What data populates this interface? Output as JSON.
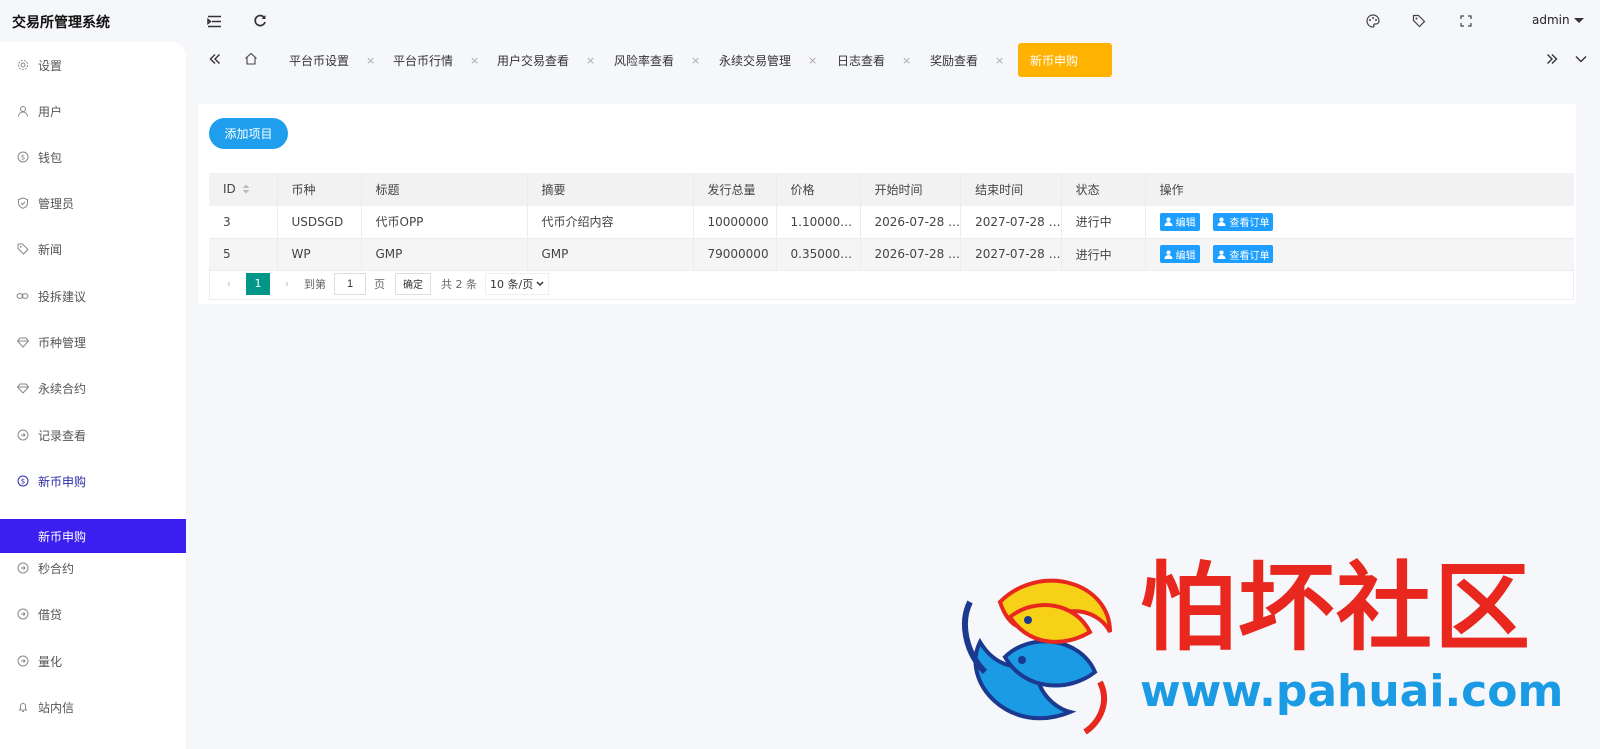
{
  "header": {
    "title": "交易所管理系统",
    "user": "admin",
    "icons": [
      "menu-fold-icon",
      "refresh-icon",
      "theme-icon",
      "tag-icon",
      "fullscreen-icon"
    ]
  },
  "sidebar": {
    "items": [
      {
        "label": "设置",
        "icon": "gear-icon"
      },
      {
        "label": "用户",
        "icon": "user-icon"
      },
      {
        "label": "钱包",
        "icon": "dollar-circle-icon"
      },
      {
        "label": "管理员",
        "icon": "shield-icon"
      },
      {
        "label": "新闻",
        "icon": "tag-icon"
      },
      {
        "label": "投拆建议",
        "icon": "link-icon"
      },
      {
        "label": "币种管理",
        "icon": "diamond-icon"
      },
      {
        "label": "永续合约",
        "icon": "diamond-icon"
      },
      {
        "label": "记录查看",
        "icon": "record-icon"
      },
      {
        "label": "新币申购",
        "icon": "dollar-circle-icon"
      },
      {
        "label": "秒合约",
        "icon": "record-icon"
      },
      {
        "label": "借贷",
        "icon": "record-icon"
      },
      {
        "label": "量化",
        "icon": "record-icon"
      },
      {
        "label": "站内信",
        "icon": "bell-icon"
      }
    ],
    "submenu_active": "新币申购"
  },
  "tabs": {
    "items": [
      {
        "label": "平台币设置"
      },
      {
        "label": "平台币行情"
      },
      {
        "label": "用户交易查看"
      },
      {
        "label": "风险率查看"
      },
      {
        "label": "永续交易管理"
      },
      {
        "label": "日志查看"
      },
      {
        "label": "奖励查看"
      }
    ],
    "active": "新币申购",
    "close_glyph": "×"
  },
  "main": {
    "add_button": "添加项目",
    "columns": [
      "ID",
      "币种",
      "标题",
      "摘要",
      "发行总量",
      "价格",
      "开始时间",
      "结束时间",
      "状态",
      "操作"
    ],
    "rows": [
      {
        "id": "3",
        "coin": "USDSGD",
        "title": "代币OPP",
        "summary": "代币介绍内容",
        "total": "10000000",
        "price": "1.10000…",
        "start": "2026-07-28 …",
        "end": "2027-07-28 …",
        "status": "进行中"
      },
      {
        "id": "5",
        "coin": "WP",
        "title": "GMP",
        "summary": "GMP",
        "total": "79000000",
        "price": "0.35000…",
        "start": "2026-07-28 …",
        "end": "2027-07-28 …",
        "status": "进行中"
      }
    ],
    "actions": {
      "edit": "编辑",
      "orders": "查看订单"
    }
  },
  "pager": {
    "current": "1",
    "goto_label": "到第",
    "page_value": "1",
    "page_unit": "页",
    "confirm": "确定",
    "total": "共 2 条",
    "page_size": "10 条/页"
  },
  "watermark": {
    "title": "怕坏社区",
    "url": "www.pahuai.com"
  },
  "colors": {
    "accent": "#1f9eee",
    "active_tab": "#ffb300",
    "active_menu": "#3b1ff0",
    "status_red": "#e60000",
    "pager_green": "#009688"
  }
}
